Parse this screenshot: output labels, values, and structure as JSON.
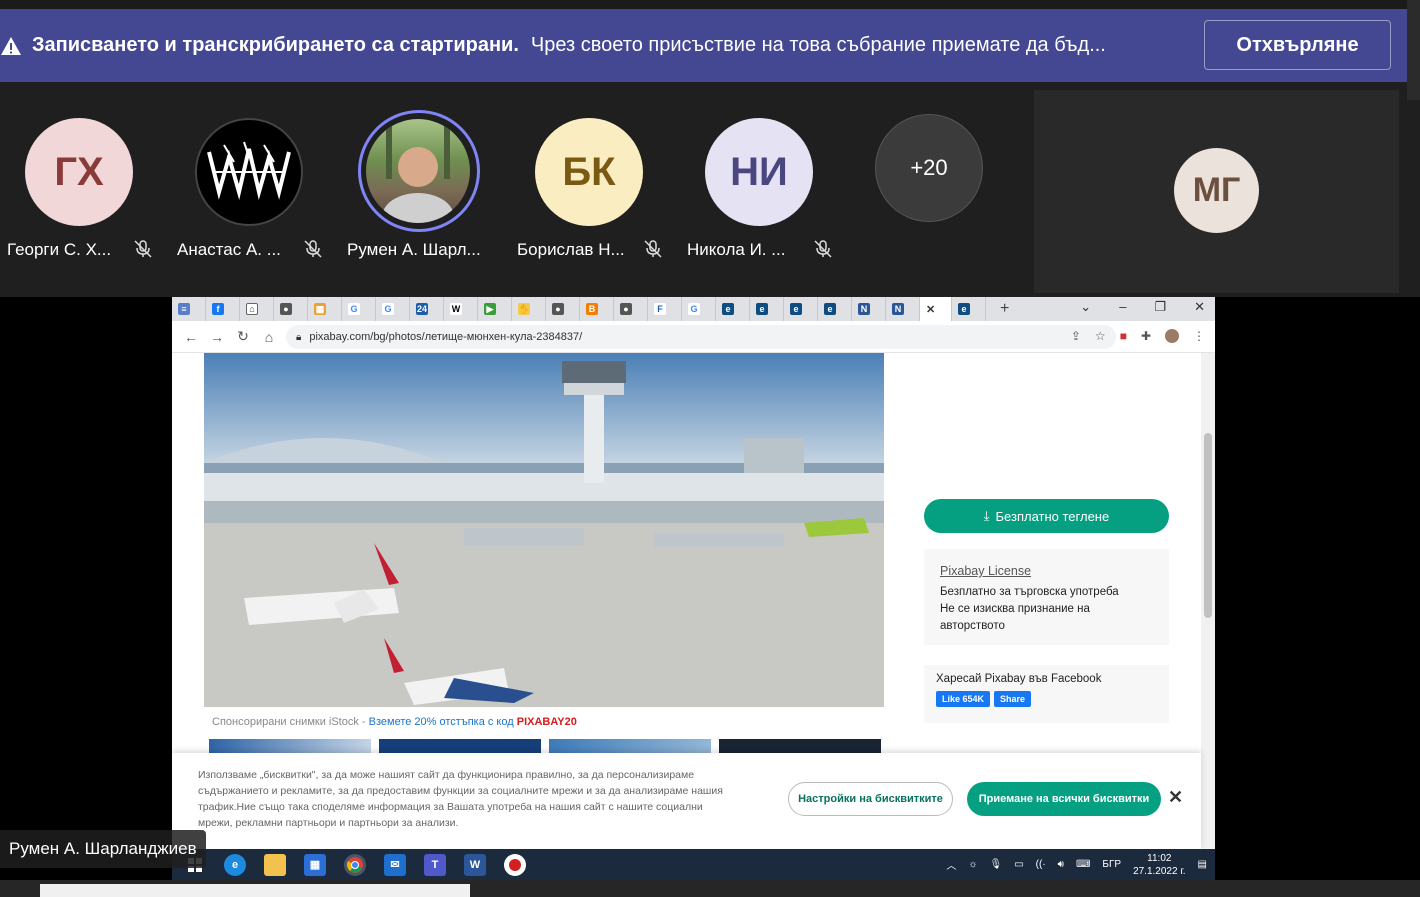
{
  "banner": {
    "title": "Записването и транскрибирането са стартирани.",
    "message": "Чрез своето присъствие на това събрание приемате да бъд...",
    "dismiss_label": "Отхвърляне"
  },
  "participants": [
    {
      "initials": "ГХ",
      "name": "Георги С. Х...",
      "bg": "#f1d7d7",
      "fg": "#8b3a3a"
    },
    {
      "initials": "",
      "name": "Анастас А. ...",
      "bg": "#000000",
      "fg": "#ffffff"
    },
    {
      "initials": "",
      "name": "Румен А. Шарл...",
      "bg": "#6b8f5a",
      "fg": "#ffffff"
    },
    {
      "initials": "БК",
      "name": "Борислав Н...",
      "bg": "#fbedc2",
      "fg": "#7a5a12"
    },
    {
      "initials": "НИ",
      "name": "Никола И. ...",
      "bg": "#e5e3f3",
      "fg": "#4a4680"
    },
    {
      "initials": "+20",
      "name": "",
      "bg": "#3b3b3b",
      "fg": "#ffffff"
    }
  ],
  "side_avatar": {
    "initials": "МГ"
  },
  "browser": {
    "url": "pixabay.com/bg/photos/летище-мюнхен-кула-2384837/"
  },
  "page": {
    "caption_prefix": "Спонсорирани снимки iStock - ",
    "caption_link": "Вземете 20% отстъпка с код ",
    "caption_code": "PIXABAY20",
    "download_label": "Безплатно теглене",
    "license_title": "Pixabay License",
    "license_line1": "Безплатно за търговска употреба",
    "license_line2": "Не се изисква признание на авторството",
    "fb_text": "Харесай Pixabay във Facebook",
    "fb_like": "Like 654K",
    "fb_share": "Share"
  },
  "cookie": {
    "text": "Използваме „бисквитки\", за да може нашият сайт да функционира правилно, за да персонализираме съдържанието и рекламите, за да предоставим функции за социалните мрежи и за да анализираме нашия трафик.Ние също така споделяме информация за Вашата употреба на нашия сайт с нашите социални мрежи, рекламни партньори и партньори за анализи.",
    "settings_label": "Настройки на бисквитките",
    "accept_label": "Приемане на всички бисквитки",
    "close_label": "✕"
  },
  "taskbar": {
    "lang": "БГР",
    "time": "11:02",
    "date": "27.1.2022 г."
  },
  "presenter_label": "Румен А. Шарланджиев"
}
